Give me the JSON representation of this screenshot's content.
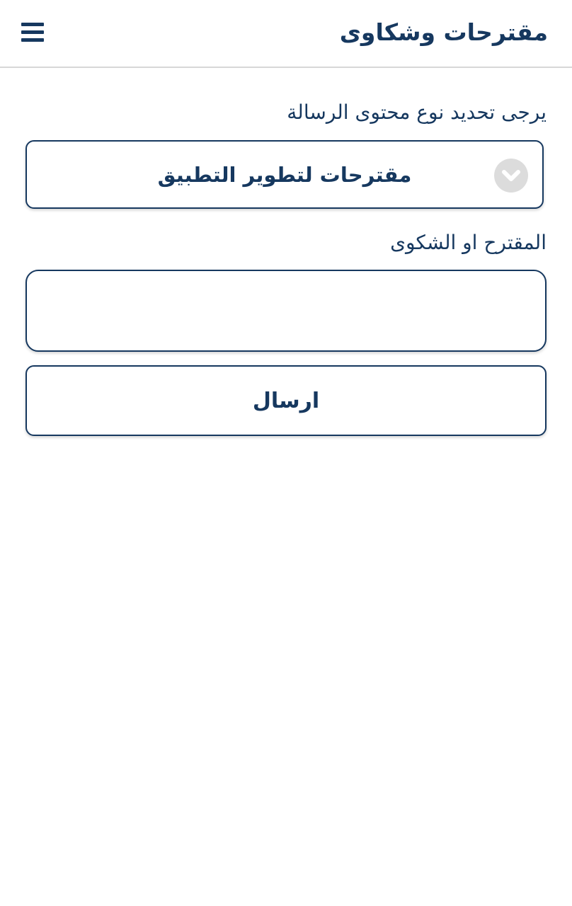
{
  "header": {
    "title": "مقترحات وشكاوى",
    "menu_icon": "hamburger-menu-icon"
  },
  "form": {
    "type_label": "يرجى تحديد نوع محتوى الرسالة",
    "type_select": {
      "selected_value": "مقترحات لتطوير التطبيق",
      "icon": "chevron-down-circle-icon"
    },
    "message_label": "المقترح او الشكوى",
    "message_input": {
      "value": "",
      "placeholder": ""
    },
    "submit_label": "ارسال"
  },
  "colors": {
    "primary": "#16385f",
    "divider": "#d7d7d7",
    "chevron_background": "#dcdcdc",
    "background": "#ffffff"
  }
}
